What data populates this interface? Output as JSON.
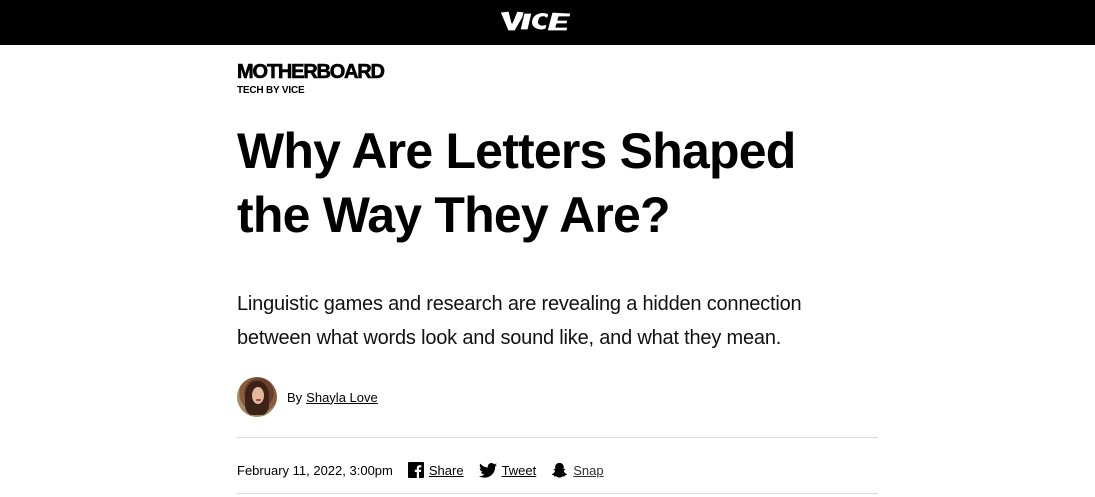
{
  "header": {
    "logo_text": "VICE",
    "background": "#000000",
    "logo_color": "#ffffff"
  },
  "section": {
    "brand": "MOTHERBOARD",
    "tagline": "TECH BY VICE"
  },
  "article": {
    "title": "Why Are Letters Shaped the Way They Are?",
    "dek": "Linguistic games and research are revealing a hidden connection between what words look and sound like, and what they mean.",
    "byline_prefix": "By",
    "author": "Shayla Love",
    "date": "February 11, 2022, 3:00pm"
  },
  "share": {
    "facebook": {
      "label": "Share",
      "icon": "facebook-icon"
    },
    "twitter": {
      "label": "Tweet",
      "icon": "twitter-icon"
    },
    "snapchat": {
      "label": "Snap",
      "icon": "snapchat-icon"
    }
  }
}
